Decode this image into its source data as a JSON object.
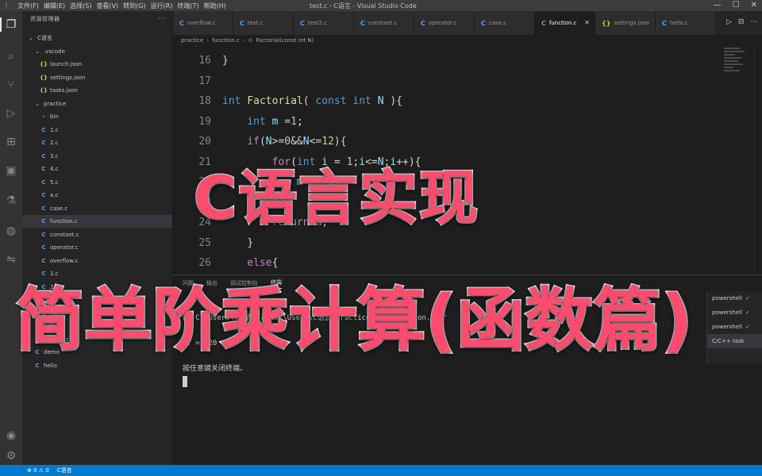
{
  "titlebar": {
    "menu": [
      "文件(F)",
      "编辑(E)",
      "选择(S)",
      "查看(V)",
      "转到(G)",
      "运行(R)",
      "终端(T)",
      "帮助(H)"
    ],
    "window_title": "test.c - C语言 - Visual Studio Code",
    "win_controls": [
      "—",
      "☐",
      "✕"
    ]
  },
  "activity_icons": [
    "files-icon",
    "search-icon",
    "source-control-icon",
    "run-debug-icon",
    "extensions-icon",
    "remote-explorer-icon",
    "testing-icon",
    "docker-icon",
    "live-share-icon",
    "account-icon",
    "settings-gear-icon"
  ],
  "sidebar": {
    "title": "资源管理器",
    "more": "···",
    "items": [
      {
        "label": "C语言",
        "icon": "chev-down",
        "indent": 0
      },
      {
        "label": ".vscode",
        "icon": "chev-down",
        "indent": 1
      },
      {
        "label": "launch.json",
        "icon": "json",
        "indent": 2
      },
      {
        "label": "settings.json",
        "icon": "json",
        "indent": 2
      },
      {
        "label": "tasks.json",
        "icon": "json",
        "indent": 2
      },
      {
        "label": "practice",
        "icon": "chev-down",
        "indent": 1
      },
      {
        "label": "bin",
        "icon": "chev-right",
        "indent": 2
      },
      {
        "label": "1.c",
        "icon": "c",
        "indent": 2
      },
      {
        "label": "2.c",
        "icon": "c",
        "indent": 2
      },
      {
        "label": "3.c",
        "icon": "c",
        "indent": 2
      },
      {
        "label": "4.c",
        "icon": "c",
        "indent": 2
      },
      {
        "label": "5.c",
        "icon": "c",
        "indent": 2
      },
      {
        "label": "a.c",
        "icon": "c",
        "indent": 2
      },
      {
        "label": "case.c",
        "icon": "c",
        "indent": 2
      },
      {
        "label": "function.c",
        "icon": "c",
        "indent": 2
      },
      {
        "label": "constant.c",
        "icon": "c",
        "indent": 2
      },
      {
        "label": "operator.c",
        "icon": "c",
        "indent": 2
      },
      {
        "label": "overflow.c",
        "icon": "c",
        "indent": 2
      },
      {
        "label": "1.c",
        "icon": "c",
        "indent": 2
      },
      {
        "label": "2.c",
        "icon": "c",
        "indent": 2
      },
      {
        "label": "3.c",
        "icon": "c",
        "indent": 2
      },
      {
        "label": "list.c",
        "icon": "c",
        "indent": 2
      },
      {
        "label": "test.c",
        "icon": "c",
        "indent": 2
      },
      {
        "label": "test2.c",
        "icon": "c",
        "indent": 2
      },
      {
        "label": "demo",
        "icon": "c",
        "indent": 1
      },
      {
        "label": "hello",
        "icon": "c",
        "indent": 1
      }
    ],
    "selected_index": 14
  },
  "tabs": [
    {
      "label": "overflow.c",
      "active": false
    },
    {
      "label": "test.c",
      "active": false
    },
    {
      "label": "test2.c",
      "active": false
    },
    {
      "label": "constant.c",
      "active": false
    },
    {
      "label": "operator.c",
      "active": false
    },
    {
      "label": "case.c",
      "active": false
    },
    {
      "label": "function.c",
      "active": true
    },
    {
      "label": "settings.json",
      "active": false
    },
    {
      "label": "hello.c",
      "active": false
    }
  ],
  "tab_actions": [
    "▷",
    "⊟",
    "···"
  ],
  "breadcrumb": [
    "practice",
    "function.c",
    "Factorial(const int N)"
  ],
  "editor_lines": [
    {
      "n": "16",
      "indent": 0,
      "tokens": [
        [
          "txt",
          "}"
        ]
      ]
    },
    {
      "n": "17",
      "indent": 0,
      "tokens": []
    },
    {
      "n": "18",
      "indent": 0,
      "tokens": [
        [
          "kw",
          "int"
        ],
        [
          "txt",
          " "
        ],
        [
          "fnn",
          "Factorial"
        ],
        [
          "txt",
          "( "
        ],
        [
          "kw",
          "const"
        ],
        [
          "txt",
          " "
        ],
        [
          "kw",
          "int"
        ],
        [
          "txt",
          " "
        ],
        [
          "var",
          "N"
        ],
        [
          "txt",
          " ){"
        ]
      ]
    },
    {
      "n": "19",
      "indent": 1,
      "tokens": [
        [
          "kw",
          "int"
        ],
        [
          "txt",
          " "
        ],
        [
          "var",
          "m"
        ],
        [
          "txt",
          " ="
        ],
        [
          "num",
          "1"
        ],
        [
          "txt",
          ";"
        ]
      ]
    },
    {
      "n": "20",
      "indent": 1,
      "tokens": [
        [
          "ctl",
          "if"
        ],
        [
          "txt",
          "("
        ],
        [
          "var",
          "N"
        ],
        [
          "txt",
          ">="
        ],
        [
          "num",
          "0"
        ],
        [
          "txt",
          "&&"
        ],
        [
          "var",
          "N"
        ],
        [
          "txt",
          "<="
        ],
        [
          "num",
          "12"
        ],
        [
          "txt",
          "){"
        ]
      ]
    },
    {
      "n": "21",
      "indent": 2,
      "tokens": [
        [
          "ctl",
          "for"
        ],
        [
          "txt",
          "("
        ],
        [
          "kw",
          "int"
        ],
        [
          "txt",
          " "
        ],
        [
          "var",
          "i"
        ],
        [
          "txt",
          " = "
        ],
        [
          "num",
          "1"
        ],
        [
          "txt",
          ";"
        ],
        [
          "var",
          "i"
        ],
        [
          "txt",
          "<="
        ],
        [
          "var",
          "N"
        ],
        [
          "txt",
          ";"
        ],
        [
          "var",
          "i"
        ],
        [
          "txt",
          "++){"
        ]
      ]
    },
    {
      "n": "22",
      "indent": 3,
      "tokens": [
        [
          "var",
          "m"
        ],
        [
          "txt",
          " *= "
        ],
        [
          "var",
          "i"
        ],
        [
          "txt",
          ";"
        ]
      ]
    },
    {
      "n": "23",
      "indent": 2,
      "tokens": [
        [
          "txt",
          "}"
        ]
      ]
    },
    {
      "n": "24",
      "indent": 2,
      "tokens": [
        [
          "ctl",
          "return"
        ],
        [
          "txt",
          " "
        ],
        [
          "var",
          "m"
        ],
        [
          "txt",
          ";"
        ]
      ]
    },
    {
      "n": "25",
      "indent": 1,
      "tokens": [
        [
          "txt",
          "}"
        ]
      ]
    },
    {
      "n": "26",
      "indent": 1,
      "tokens": [
        [
          "ctl",
          "else"
        ],
        [
          "txt",
          "{"
        ]
      ]
    }
  ],
  "panel": {
    "tabs": [
      "问题",
      "输出",
      "调试控制台",
      "终端"
    ],
    "active_tab": 3,
    "terminal_lines": [
      "",
      "PS C:\\Users\\C语言> & 'c:\\Users\\C语言\\practice\\bin\\function.exe'",
      "",
      "5! = 120",
      "",
      "按任意键关闭终端。"
    ],
    "side_items": [
      {
        "label": "powershell",
        "check": true
      },
      {
        "label": "powershell",
        "check": true
      },
      {
        "label": "powershell",
        "check": true
      },
      {
        "label": "C/C++ task",
        "check": false
      }
    ]
  },
  "statusbar": {
    "items": [
      "⊗ 0 ⚠ 0",
      "C语言"
    ]
  },
  "overlay": {
    "line1": "C语言实现",
    "line2": "简单阶乘计算(函数篇)"
  }
}
